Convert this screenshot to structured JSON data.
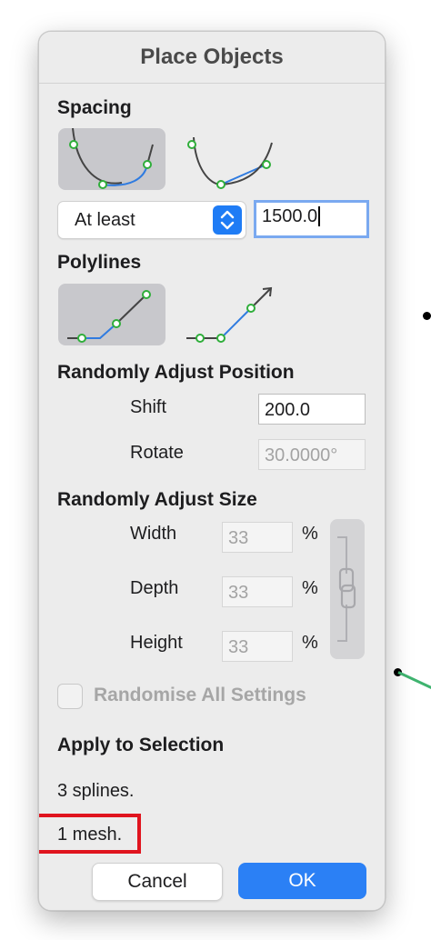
{
  "dialog": {
    "title": "Place Objects"
  },
  "spacing": {
    "title": "Spacing",
    "mode_options": [
      "uniform-curve",
      "proportional-curve"
    ],
    "selected_mode": "uniform-curve",
    "select_value": "At least",
    "value": "1500.0"
  },
  "polylines": {
    "title": "Polylines",
    "mode_options": [
      "follow-segments",
      "straight"
    ],
    "selected_mode": "follow-segments"
  },
  "position": {
    "title": "Randomly Adjust Position",
    "shift_label": "Shift",
    "shift_value": "200.0",
    "rotate_label": "Rotate",
    "rotate_value": "30.0000°"
  },
  "size": {
    "title": "Randomly Adjust Size",
    "width_label": "Width",
    "width_value": "33",
    "depth_label": "Depth",
    "depth_value": "33",
    "height_label": "Height",
    "height_value": "33",
    "unit": "%"
  },
  "randomise": {
    "label": "Randomise All Settings",
    "checked": false
  },
  "apply": {
    "title": "Apply to Selection",
    "splines_text": "3 splines.",
    "mesh_text": "1 mesh."
  },
  "buttons": {
    "cancel": "Cancel",
    "ok": "OK"
  },
  "colors": {
    "accent": "#2b80f5",
    "highlight": "#e0141e",
    "point_green": "#2fae3a",
    "curve_blue": "#2f7be0"
  }
}
